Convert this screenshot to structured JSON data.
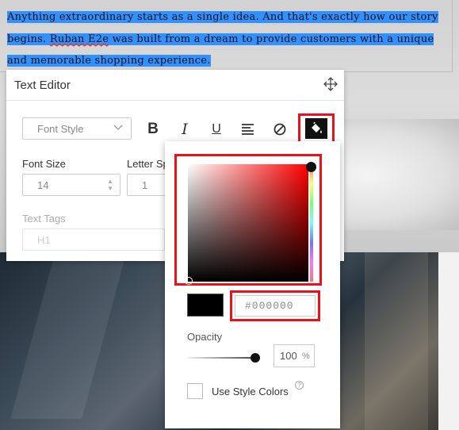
{
  "content": {
    "line1": "Anything extraordinary starts as a single idea. And that's exactly how our story",
    "line2_start": "begins.",
    "line2_brand": "Ruban E2e",
    "line2_end": "was built from a dream to provide customers with a unique",
    "line3": "and memorable shopping experience."
  },
  "editor": {
    "title": "Text Editor",
    "font_style_placeholder": "Font Style",
    "bold_label": "B",
    "italic_label": "I",
    "underline_label": "U",
    "font_size_label": "Font Size",
    "font_size_value": "14",
    "letter_spacing_label": "Letter Sp",
    "letter_spacing_value": "1",
    "text_tags_label": "Text Tags",
    "text_tags_value": "H1"
  },
  "color_picker": {
    "hex_value": "#000000",
    "opacity_label": "Opacity",
    "opacity_value": "100",
    "opacity_unit": "%",
    "use_style_colors_label": "Use Style Colors",
    "help_glyph": "?",
    "selected_color": "#000000",
    "hue_color": "#ff0000",
    "opacity_fraction": 1.0
  },
  "colors": {
    "highlight": "#3390ff",
    "annotation_red": "#e8131a"
  }
}
